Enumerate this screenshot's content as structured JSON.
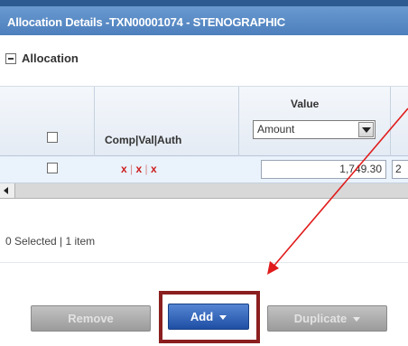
{
  "window": {
    "title": "Allocation Details -TXN00001074 - STENOGRAPHIC"
  },
  "section": {
    "title": "Allocation"
  },
  "table": {
    "columns": {
      "flags_header": "Comp|Val|Auth",
      "value_header": "Value",
      "value_type_selected": "Amount"
    },
    "rows": [
      {
        "flags": [
          "x",
          "x",
          "x"
        ],
        "separator": "|",
        "amount": "1,749.30",
        "amount_next_partial": "2"
      }
    ]
  },
  "status": {
    "text": "0 Selected | 1 item"
  },
  "actions": {
    "remove_label": "Remove",
    "add_label": "Add",
    "duplicate_label": "Duplicate"
  },
  "annotation": {
    "highlight_color": "#8b1f1f",
    "arrow_color": "#e01b1b"
  },
  "colors": {
    "title_bar": "#4d7fbd",
    "row_highlight": "#eaf2fb",
    "flag_red": "#cc1d1d",
    "primary_button": "#1e4fa4"
  }
}
